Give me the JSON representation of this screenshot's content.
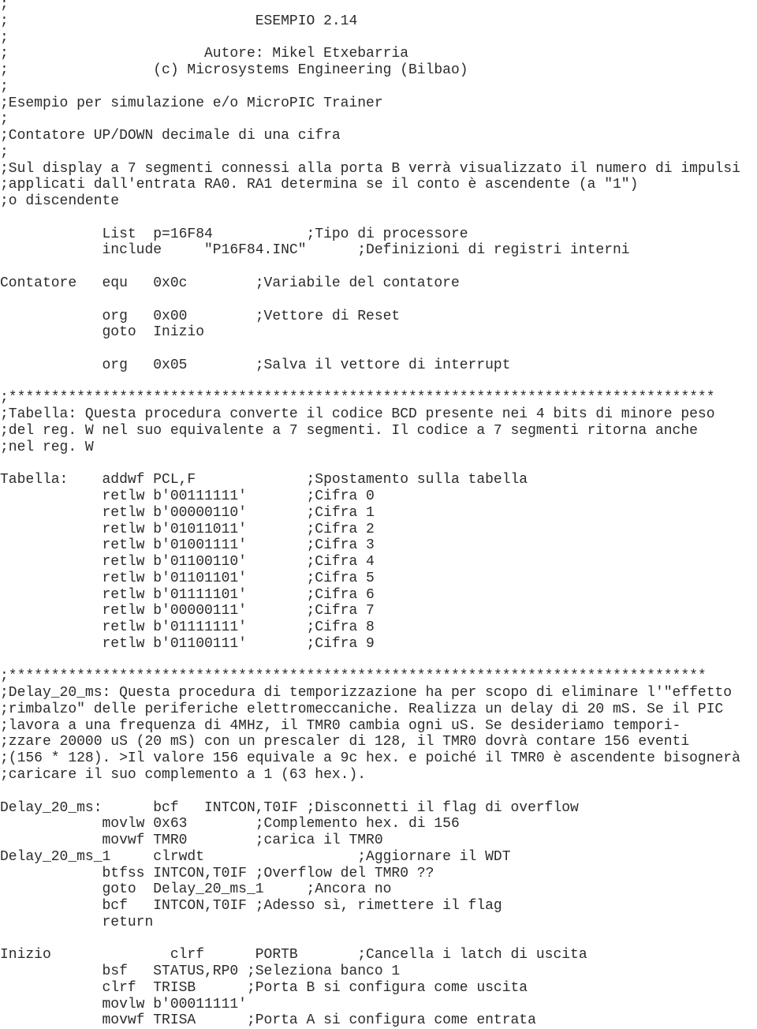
{
  "document": {
    "title": "ESEMPIO 2.14",
    "author": "Autore: Mikel Etxebarria",
    "copyright": "(c) Microsystems Engineering (Bilbao)",
    "lines": [
      {
        "kind": "comment",
        "text": ";"
      },
      {
        "kind": "comment",
        "text": ";                             ESEMPIO 2.14"
      },
      {
        "kind": "comment",
        "text": ";"
      },
      {
        "kind": "comment",
        "text": ";                       Autore: Mikel Etxebarria"
      },
      {
        "kind": "comment",
        "text": ";                 (c) Microsystems Engineering (Bilbao)"
      },
      {
        "kind": "comment",
        "text": ";"
      },
      {
        "kind": "comment",
        "text": ";Esempio per simulazione e/o MicroPIC Trainer"
      },
      {
        "kind": "comment",
        "text": ";"
      },
      {
        "kind": "comment",
        "text": ";Contatore UP/DOWN decimale di una cifra"
      },
      {
        "kind": "comment",
        "text": ";"
      },
      {
        "kind": "comment",
        "text": ";Sul display a 7 segmenti connessi alla porta B verrà visualizzato il numero di impulsi"
      },
      {
        "kind": "comment",
        "text": ";applicati dall'entrata RA0. RA1 determina se il conto è ascendente (a \"1\")"
      },
      {
        "kind": "comment",
        "text": ";o discendente"
      },
      {
        "kind": "blank",
        "text": ""
      },
      {
        "kind": "code",
        "text": "            List  p=16F84           ;Tipo di processore"
      },
      {
        "kind": "code",
        "text": "            include     \"P16F84.INC\"      ;Definizioni di registri interni"
      },
      {
        "kind": "blank",
        "text": ""
      },
      {
        "kind": "code",
        "text": "Contatore   equ   0x0c        ;Variabile del contatore"
      },
      {
        "kind": "blank",
        "text": ""
      },
      {
        "kind": "code",
        "text": "            org   0x00        ;Vettore di Reset"
      },
      {
        "kind": "code",
        "text": "            goto  Inizio"
      },
      {
        "kind": "blank",
        "text": ""
      },
      {
        "kind": "code",
        "text": "            org   0x05        ;Salva il vettore di interrupt"
      },
      {
        "kind": "blank",
        "text": ""
      },
      {
        "kind": "comment",
        "text": ";***********************************************************************************"
      },
      {
        "kind": "comment",
        "text": ";Tabella: Questa procedura converte il codice BCD presente nei 4 bits di minore peso"
      },
      {
        "kind": "comment",
        "text": ";del reg. W nel suo equivalente a 7 segmenti. Il codice a 7 segmenti ritorna anche"
      },
      {
        "kind": "comment",
        "text": ";nel reg. W"
      },
      {
        "kind": "blank",
        "text": ""
      },
      {
        "kind": "code",
        "text": "Tabella:    addwf PCL,F             ;Spostamento sulla tabella"
      },
      {
        "kind": "code",
        "text": "            retlw b'00111111'       ;Cifra 0"
      },
      {
        "kind": "code",
        "text": "            retlw b'00000110'       ;Cifra 1"
      },
      {
        "kind": "code",
        "text": "            retlw b'01011011'       ;Cifra 2"
      },
      {
        "kind": "code",
        "text": "            retlw b'01001111'       ;Cifra 3"
      },
      {
        "kind": "code",
        "text": "            retlw b'01100110'       ;Cifra 4"
      },
      {
        "kind": "code",
        "text": "            retlw b'01101101'       ;Cifra 5"
      },
      {
        "kind": "code",
        "text": "            retlw b'01111101'       ;Cifra 6"
      },
      {
        "kind": "code",
        "text": "            retlw b'00000111'       ;Cifra 7"
      },
      {
        "kind": "code",
        "text": "            retlw b'01111111'       ;Cifra 8"
      },
      {
        "kind": "code",
        "text": "            retlw b'01100111'       ;Cifra 9"
      },
      {
        "kind": "blank",
        "text": ""
      },
      {
        "kind": "comment",
        "text": ";**********************************************************************************"
      },
      {
        "kind": "comment",
        "text": ";Delay_20_ms: Questa procedura di temporizzazione ha per scopo di eliminare l'\"effetto"
      },
      {
        "kind": "comment",
        "text": ";rimbalzo\" delle periferiche elettromeccaniche. Realizza un delay di 20 mS. Se il PIC"
      },
      {
        "kind": "comment",
        "text": ";lavora a una frequenza di 4MHz, il TMR0 cambia ogni uS. Se desideriamo tempori-"
      },
      {
        "kind": "comment",
        "text": ";zzare 20000 uS (20 mS) con un prescaler di 128, il TMR0 dovrà contare 156 eventi"
      },
      {
        "kind": "comment",
        "text": ";(156 * 128). >Il valore 156 equivale a 9c hex. e poiché il TMR0 è ascendente bisognerà"
      },
      {
        "kind": "comment",
        "text": ";caricare il suo complemento a 1 (63 hex.)."
      },
      {
        "kind": "blank",
        "text": ""
      },
      {
        "kind": "code",
        "text": "Delay_20_ms:      bcf   INTCON,T0IF ;Disconnetti il flag di overflow"
      },
      {
        "kind": "code",
        "text": "            movlw 0x63        ;Complemento hex. di 156"
      },
      {
        "kind": "code",
        "text": "            movwf TMR0        ;carica il TMR0"
      },
      {
        "kind": "code",
        "text": "Delay_20_ms_1     clrwdt                  ;Aggiornare il WDT"
      },
      {
        "kind": "code",
        "text": "            btfss INTCON,T0IF ;Overflow del TMR0 ??"
      },
      {
        "kind": "code",
        "text": "            goto  Delay_20_ms_1     ;Ancora no"
      },
      {
        "kind": "code",
        "text": "            bcf   INTCON,T0IF ;Adesso sì, rimettere il flag"
      },
      {
        "kind": "code",
        "text": "            return"
      },
      {
        "kind": "blank",
        "text": ""
      },
      {
        "kind": "code",
        "text": "Inizio              clrf      PORTB       ;Cancella i latch di uscita"
      },
      {
        "kind": "code",
        "text": "            bsf   STATUS,RP0 ;Seleziona banco 1"
      },
      {
        "kind": "code",
        "text": "            clrf  TRISB      ;Porta B si configura come uscita"
      },
      {
        "kind": "code",
        "text": "            movlw b'00011111'"
      },
      {
        "kind": "code",
        "text": "            movwf TRISA      ;Porta A si configura come entrata"
      }
    ]
  }
}
